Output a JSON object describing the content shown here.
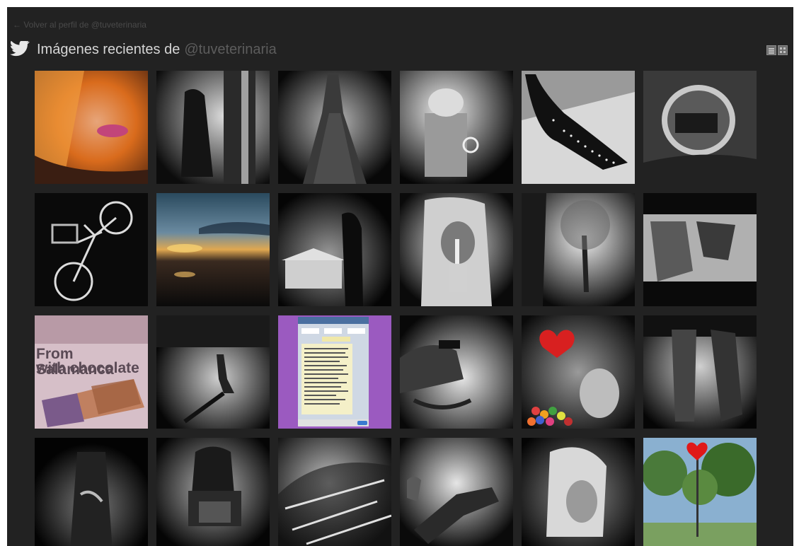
{
  "back_link": {
    "prefix": "← Volver al perfil de ",
    "handle": "@tuveterinaria"
  },
  "header": {
    "title": "Imágenes recientes de",
    "handle": "@tuveterinaria",
    "view_toggle": [
      "list-view-icon",
      "grid-view-icon"
    ]
  },
  "photos": [
    {
      "id": "tile-1",
      "subject": "selfie-blonde"
    },
    {
      "id": "tile-2",
      "subject": "woman-in-doorway"
    },
    {
      "id": "tile-3",
      "subject": "lace-dress"
    },
    {
      "id": "tile-4",
      "subject": "figurine-cup"
    },
    {
      "id": "tile-5",
      "subject": "studded-heel"
    },
    {
      "id": "tile-6",
      "subject": "round-window"
    },
    {
      "id": "tile-7",
      "subject": "bicycle"
    },
    {
      "id": "tile-8",
      "subject": "sunset-lake"
    },
    {
      "id": "tile-9",
      "subject": "house-silhouette"
    },
    {
      "id": "tile-10",
      "subject": "shh-portrait"
    },
    {
      "id": "tile-11",
      "subject": "tree-street"
    },
    {
      "id": "tile-12",
      "subject": "boots"
    },
    {
      "id": "tile-13",
      "subject": "chocolate-bar",
      "caption_line1": "From Salamanca",
      "caption_line2": "with chocolate"
    },
    {
      "id": "tile-14",
      "subject": "kid-running"
    },
    {
      "id": "tile-15",
      "subject": "chat-screenshot"
    },
    {
      "id": "tile-16",
      "subject": "hands-bracelet"
    },
    {
      "id": "tile-17",
      "subject": "red-heart-candy"
    },
    {
      "id": "tile-18",
      "subject": "legs-boots"
    },
    {
      "id": "tile-19",
      "subject": "dark-figure"
    },
    {
      "id": "tile-20",
      "subject": "armchair"
    },
    {
      "id": "tile-21",
      "subject": "hair-closeup"
    },
    {
      "id": "tile-22",
      "subject": "shadow-legs"
    },
    {
      "id": "tile-23",
      "subject": "blonde-profile"
    },
    {
      "id": "tile-24",
      "subject": "red-heart-trees"
    }
  ]
}
